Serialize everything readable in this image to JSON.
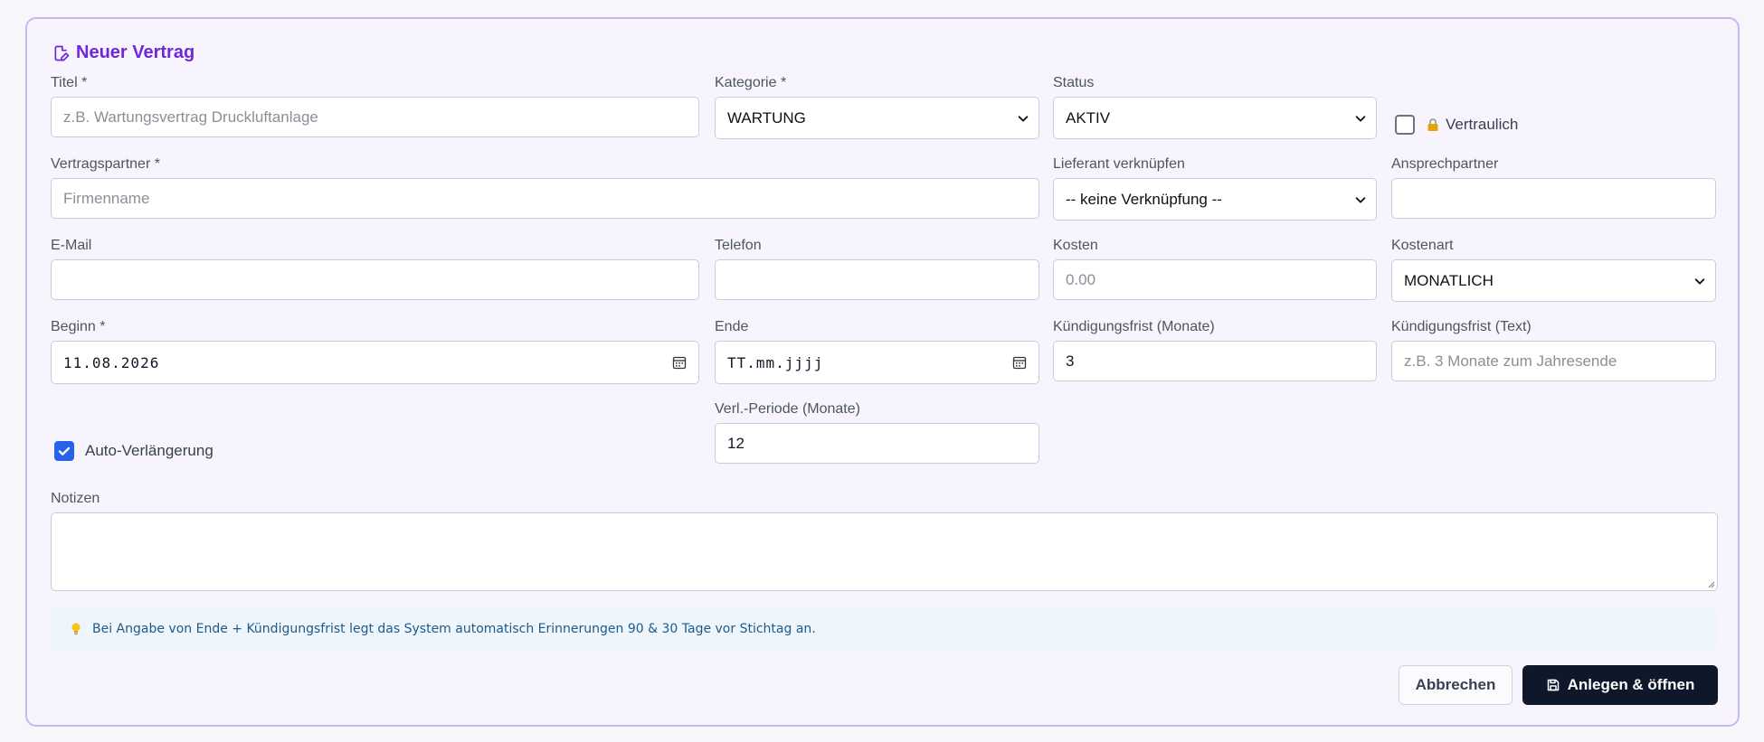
{
  "form": {
    "title": "Neuer Vertrag",
    "fields": {
      "titel": {
        "label": "Titel *",
        "placeholder": "z.B. Wartungsvertrag Druckluftanlage",
        "value": ""
      },
      "kategorie": {
        "label": "Kategorie *",
        "value": "WARTUNG"
      },
      "status": {
        "label": "Status",
        "value": "AKTIV"
      },
      "vertraulich": {
        "label": "Vertraulich",
        "checked": false
      },
      "vertragspartner": {
        "label": "Vertragspartner *",
        "placeholder": "Firmenname",
        "value": ""
      },
      "lieferant": {
        "label": "Lieferant verknüpfen",
        "value": "-- keine Verknüpfung --"
      },
      "ansprechpartner": {
        "label": "Ansprechpartner",
        "value": ""
      },
      "email": {
        "label": "E-Mail",
        "value": ""
      },
      "telefon": {
        "label": "Telefon",
        "value": ""
      },
      "kosten": {
        "label": "Kosten",
        "placeholder": "0.00",
        "value": ""
      },
      "kostenart": {
        "label": "Kostenart",
        "value": "MONATLICH"
      },
      "beginn": {
        "label": "Beginn *",
        "value": "11.08.2026"
      },
      "ende": {
        "label": "Ende",
        "value": "TT.mm.jjjj"
      },
      "kuendigungsfrist_monate": {
        "label": "Kündigungsfrist (Monate)",
        "value": "3"
      },
      "kuendigungsfrist_text": {
        "label": "Kündigungsfrist (Text)",
        "placeholder": "z.B. 3 Monate zum Jahresende",
        "value": ""
      },
      "auto_verlaengerung": {
        "label": "Auto-Verlängerung",
        "checked": true
      },
      "verl_periode": {
        "label": "Verl.-Periode (Monate)",
        "value": "12"
      },
      "notizen": {
        "label": "Notizen",
        "value": ""
      }
    },
    "hint": "Bei Angabe von Ende + Kündigungsfrist legt das System automatisch Erinnerungen 90 & 30 Tage vor Stichtag an.",
    "buttons": {
      "cancel": "Abbrechen",
      "submit": "Anlegen & öffnen"
    }
  },
  "icons": {
    "title": "edit-document-icon",
    "lock": "lock-icon",
    "hint": "lightbulb-icon",
    "save": "save-icon",
    "calendar": "calendar-icon",
    "chevron": "chevron-down-icon"
  },
  "colors": {
    "accent": "#6d28d9",
    "card_border": "#c9b6ef",
    "primary_button": "#0f172a",
    "checkbox_checked": "#2563eb",
    "hint_bg": "#eef5fb",
    "hint_text": "#1e5a8a"
  }
}
